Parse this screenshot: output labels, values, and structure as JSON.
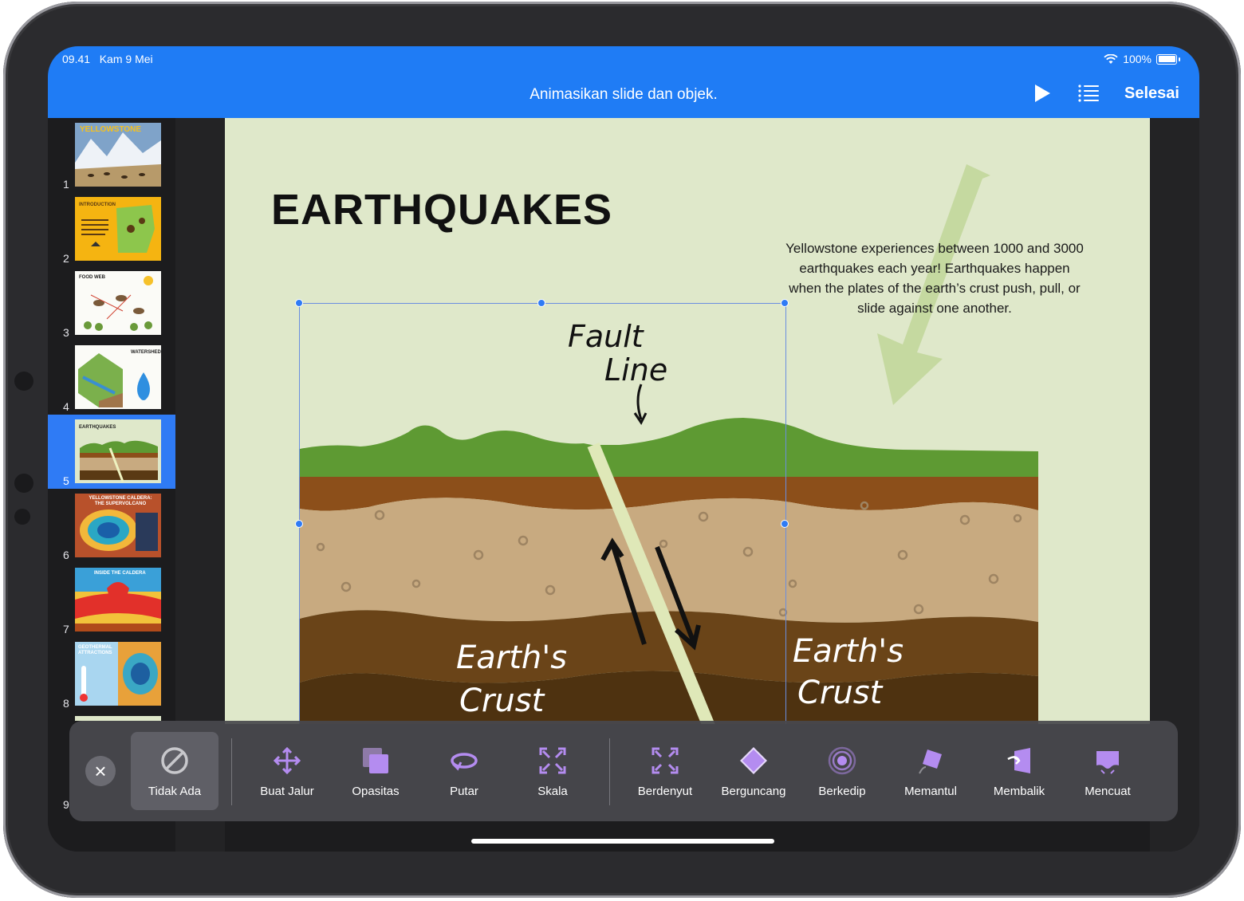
{
  "status": {
    "time": "09.41",
    "date": "Kam 9 Mei",
    "battery": "100%"
  },
  "toolbar": {
    "title": "Animasikan slide dan objek.",
    "done_label": "Selesai",
    "play_icon": "play-icon",
    "list_icon": "list-icon"
  },
  "navigator": {
    "slides": [
      {
        "num": "1",
        "title": "YELLOWSTONE"
      },
      {
        "num": "2",
        "title": "INTRODUCTION"
      },
      {
        "num": "3",
        "title": "FOOD WEB"
      },
      {
        "num": "4",
        "title": "WATERSHED"
      },
      {
        "num": "5",
        "title": "EARTHQUAKES",
        "selected": true
      },
      {
        "num": "6",
        "title": "YELLOWSTONE CALDERA: THE SUPERVOLCANO"
      },
      {
        "num": "7",
        "title": "INSIDE THE CALDERA"
      },
      {
        "num": "8",
        "title": "GEOTHERMAL ATTRACTIONS"
      },
      {
        "num": "9",
        "title": ""
      }
    ]
  },
  "slide": {
    "title": "EARTHQUAKES",
    "body": "Yellowstone experiences between 1000 and 3000 earthquakes each year! Earthquakes happen when the plates of the earth’s crust push, pull, or slide against one another.",
    "fault_label_1": "Fault",
    "fault_label_2": "Line",
    "crust_left_1": "Earth's",
    "crust_left_2": "Crust",
    "crust_right_1": "Earth's",
    "crust_right_2": "Crust",
    "colors": {
      "background": "#dfe8ca",
      "grass": "#5e9a33",
      "topsoil": "#8c4f1a",
      "sand": "#c8aa80",
      "deep": "#5a3a14",
      "fault": "#dfe8b8"
    }
  },
  "animations": {
    "close_icon": "close-icon",
    "items": [
      {
        "label": "Tidak Ada",
        "icon": "none-icon",
        "selected": true
      },
      {
        "label": "Buat Jalur",
        "icon": "move-path-icon"
      },
      {
        "label": "Opasitas",
        "icon": "opacity-icon"
      },
      {
        "label": "Putar",
        "icon": "rotate-icon"
      },
      {
        "label": "Skala",
        "icon": "scale-icon"
      },
      {
        "label": "Berdenyut",
        "icon": "pulse-icon"
      },
      {
        "label": "Berguncang",
        "icon": "jiggle-icon"
      },
      {
        "label": "Berkedip",
        "icon": "blink-icon"
      },
      {
        "label": "Memantul",
        "icon": "bounce-icon"
      },
      {
        "label": "Membalik",
        "icon": "flip-icon"
      },
      {
        "label": "Mencuat",
        "icon": "pop-icon"
      }
    ],
    "accent": "#b48cf0"
  }
}
